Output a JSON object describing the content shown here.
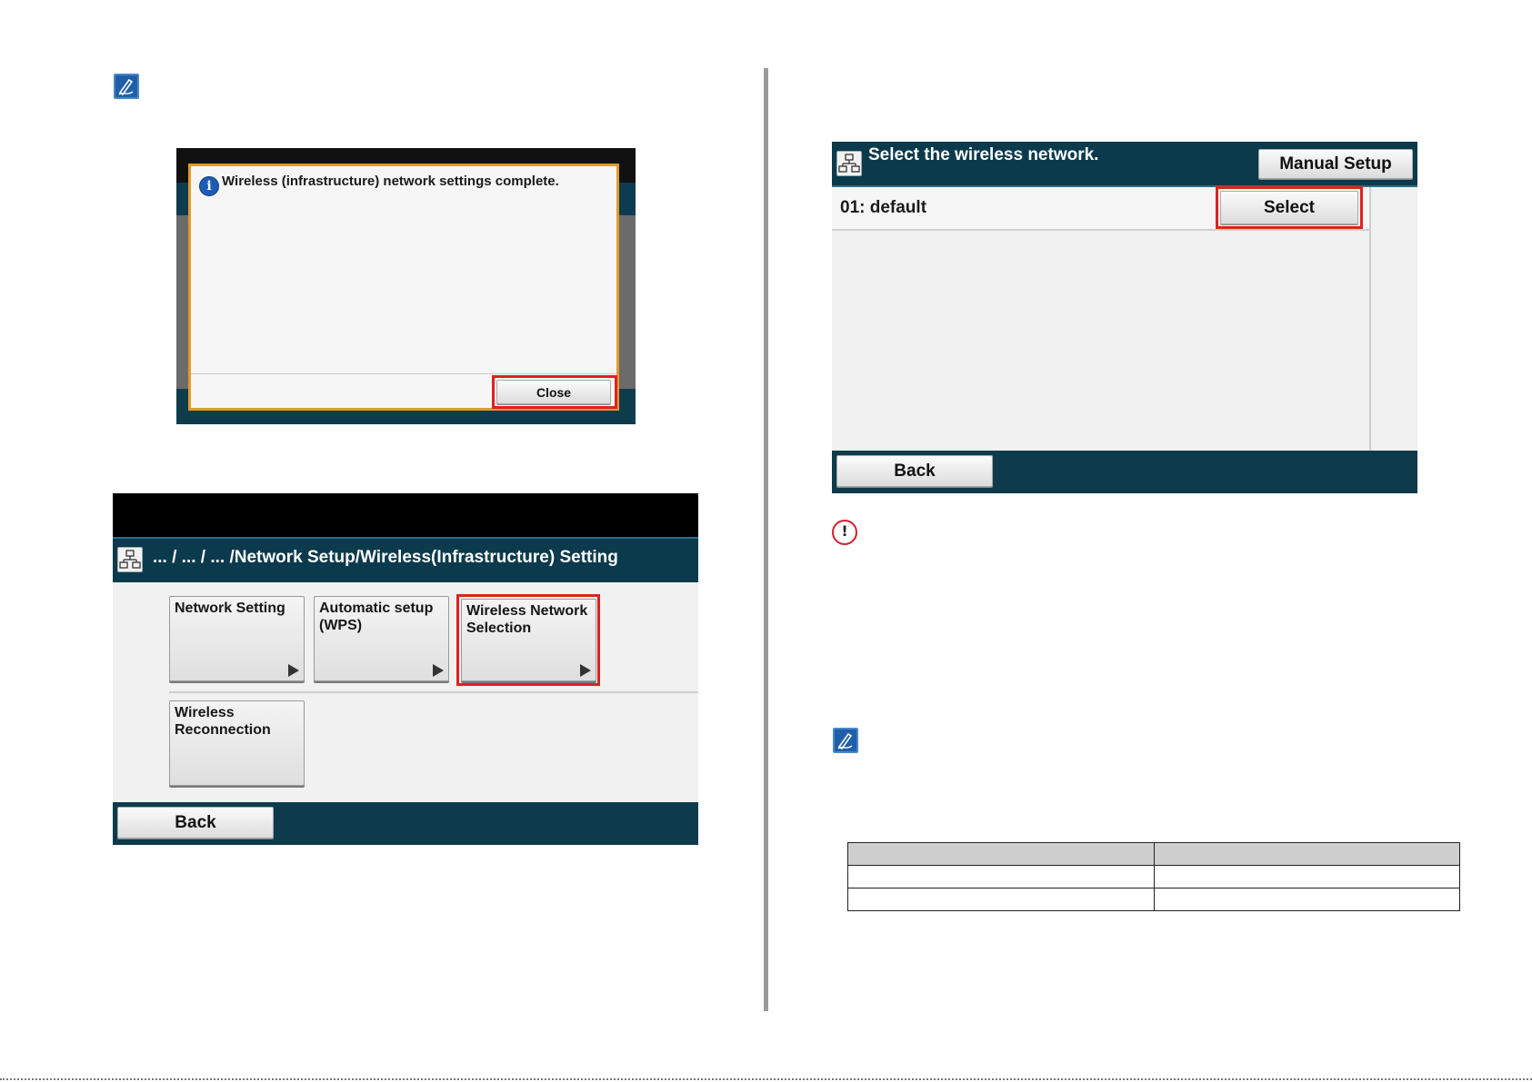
{
  "dialog_screen": {
    "message": "Wireless (infrastructure) network settings complete.",
    "info_glyph": "i",
    "close_label": "Close"
  },
  "setting_screen": {
    "breadcrumb": "... / ... / ... /Network Setup/Wireless(Infrastructure) Setting",
    "tiles": [
      {
        "label": "Network Setting"
      },
      {
        "label": "Automatic setup (WPS)"
      },
      {
        "label": "Wireless Network Selection"
      },
      {
        "label": "Wireless Reconnection"
      }
    ],
    "back_label": "Back"
  },
  "network_screen": {
    "title": "Select the wireless network.",
    "manual_setup_label": "Manual Setup",
    "networks": [
      {
        "label": "01: default",
        "select_label": "Select"
      }
    ],
    "back_label": "Back"
  },
  "caution_glyph": "!",
  "icons": {
    "note": "note-pencil-icon",
    "caution": "caution-icon",
    "info": "info-icon",
    "network": "network-icon",
    "arrow": "triangle-right-icon"
  },
  "colors": {
    "highlight": "#e02020",
    "header_teal": "#0b3a4c",
    "dialog_border": "#e39a2a",
    "note_blue": "#1f5fa8"
  }
}
